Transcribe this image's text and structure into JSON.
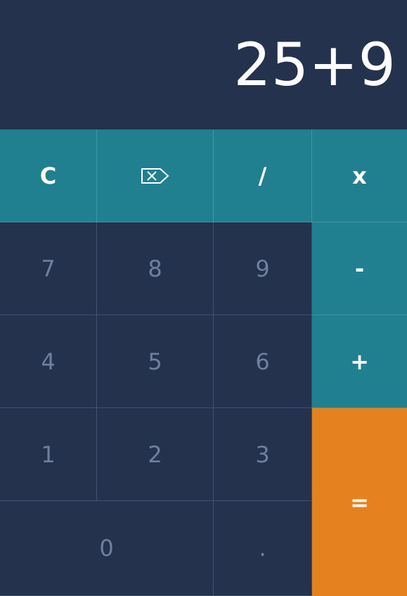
{
  "display": {
    "value": "25+9"
  },
  "keys": {
    "clear": "C",
    "backspace_icon": "backspace-icon",
    "divide": "/",
    "multiply": "x",
    "subtract": "-",
    "add": "+",
    "equals": "=",
    "seven": "7",
    "eight": "8",
    "nine": "9",
    "four": "4",
    "five": "5",
    "six": "6",
    "one": "1",
    "two": "2",
    "three": "3",
    "zero": "0",
    "decimal": "."
  },
  "colors": {
    "background": "#24324d",
    "operator": "#21808f",
    "equals": "#e5821f",
    "digit_text": "#6f7f9c",
    "display_text": "#ffffff"
  }
}
